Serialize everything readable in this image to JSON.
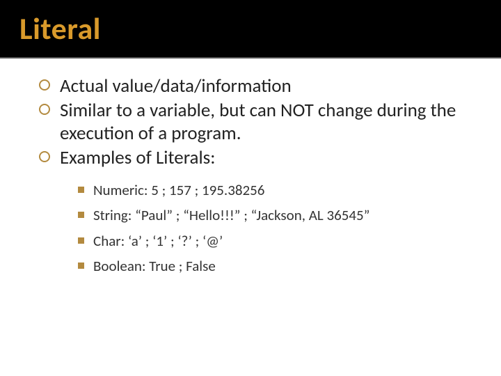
{
  "header": {
    "title": "Literal"
  },
  "bullets": {
    "b1": "Actual value/data/information",
    "b2": "Similar to a variable, but can NOT change during the execution of a program.",
    "b3": "Examples of Literals:"
  },
  "subs": {
    "s1": "Numeric:  5 ; 157 ; 195.38256",
    "s2": "String:  “Paul” ; “Hello!!!” ; “Jackson, AL 36545”",
    "s3": "Char:  ‘a’ ; ‘1’ ; ‘?’ ; ‘@’",
    "s4": "Boolean:  True ; False"
  }
}
